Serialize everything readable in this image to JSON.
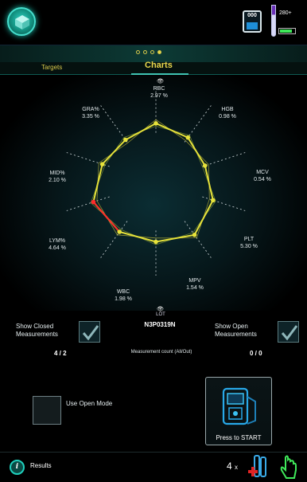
{
  "status_bar": {
    "counter_value": "000",
    "sample_tube_level": "280+"
  },
  "header": {
    "page_indicator": {
      "count": 4,
      "active": 3
    },
    "tabs": {
      "targets": "Targets",
      "charts": "Charts"
    }
  },
  "chart_data": {
    "type": "radar",
    "axes": [
      {
        "name": "RBC",
        "value_text": "2.97 %"
      },
      {
        "name": "HGB",
        "value_text": "0.98 %"
      },
      {
        "name": "MCV",
        "value_text": "0.54 %"
      },
      {
        "name": "PLT",
        "value_text": "5.30 %"
      },
      {
        "name": "MPV",
        "value_text": "1.54 %"
      },
      {
        "name": "LOT",
        "value_text": ""
      },
      {
        "name": "WBC",
        "value_text": "1.98 %"
      },
      {
        "name": "LYM%",
        "value_text": "4.64 %"
      },
      {
        "name": "MID%",
        "value_text": "2.10 %"
      },
      {
        "name": "GRA%",
        "value_text": "3.35 %"
      }
    ],
    "series_values": [
      0.62,
      0.58,
      0.55,
      0.64,
      0.7,
      0.64,
      0.66,
      0.7,
      0.6,
      0.55
    ],
    "highlight_segment": [
      6,
      7
    ],
    "colors": {
      "line": "#e6e23a",
      "highlight": "#ff2a2a",
      "grid": "#cfd8da"
    }
  },
  "lot": {
    "label": "LOT",
    "value": "N3P0319N"
  },
  "measurements": {
    "show_closed_label": "Show Closed Measurements",
    "show_open_label": "Show Open Measurements",
    "closed_count": "4 / 2",
    "open_count": "0 / 0",
    "count_caption": "Measurement count (All/Out)",
    "show_closed_checked": true,
    "show_open_checked": true
  },
  "open_mode": {
    "label": "Use Open Mode",
    "checked": false
  },
  "start_button": {
    "label": "Press to START"
  },
  "footer": {
    "results_label": "Results",
    "multiplier": "4",
    "multiplier_suffix": "x"
  }
}
